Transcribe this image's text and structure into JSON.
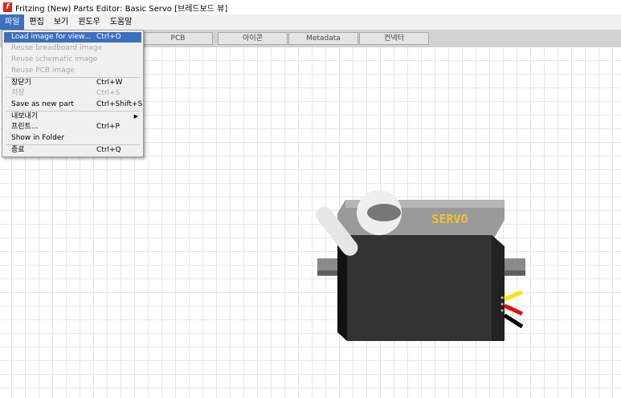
{
  "window": {
    "title": "Fritzing (New) Parts Editor: Basic Servo [브레드보드 뷰]",
    "app_icon": "f"
  },
  "menubar": [
    "파일",
    "편집",
    "보기",
    "윈도우",
    "도움말"
  ],
  "tabs": [
    "PCB",
    "아이콘",
    "Metadata",
    "컨넥터"
  ],
  "file_menu": [
    {
      "label": "Load image for view...",
      "shortcut": "Ctrl+O"
    },
    {
      "label": "Reuse breadboard image",
      "shortcut": ""
    },
    {
      "label": "Reuse schematic image",
      "shortcut": ""
    },
    {
      "label": "Reuse PCB image",
      "shortcut": ""
    },
    {
      "label": "창닫기",
      "shortcut": "Ctrl+W"
    },
    {
      "label": "저장",
      "shortcut": "Ctrl+S"
    },
    {
      "label": "Save as new part",
      "shortcut": "Ctrl+Shift+S"
    },
    {
      "label": "내보내기",
      "shortcut": ""
    },
    {
      "label": "프린트...",
      "shortcut": "Ctrl+P"
    },
    {
      "label": "Show in Folder",
      "shortcut": ""
    },
    {
      "label": "종료",
      "shortcut": "Ctrl+Q"
    }
  ],
  "servo": {
    "label": "SERVO",
    "body_color": "#333333",
    "label_color": "#f2c12e",
    "wire_colors": [
      "#f5e600",
      "#e01010",
      "#000000"
    ]
  },
  "colors": {
    "menu_highlight": "#3d6fbf",
    "app_icon": "#d9261c"
  }
}
